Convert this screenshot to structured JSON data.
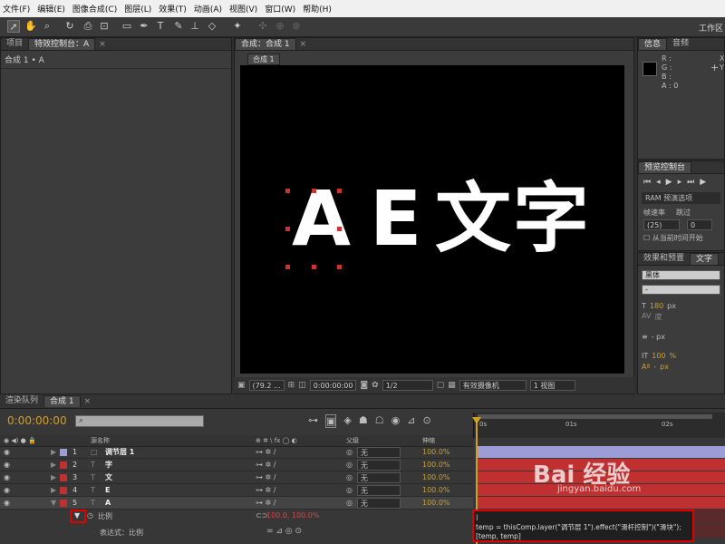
{
  "menu": [
    "文件(F)",
    "编辑(E)",
    "图像合成(C)",
    "图层(L)",
    "效果(T)",
    "动画(A)",
    "视图(V)",
    "窗口(W)",
    "帮助(H)"
  ],
  "workspace_label": "工作区",
  "left_panel": {
    "tabs": [
      "项目",
      "特效控制台：A"
    ],
    "subtitle": "合成 1 • A"
  },
  "viewer": {
    "tab": "合成：合成 1",
    "subtab": "合成 1",
    "comp_text": [
      "A",
      "E",
      "文",
      "字"
    ],
    "controls": {
      "zoom": "(79.2 ...",
      "time": "0:00:00:00",
      "resolution": "1/2",
      "camera": "有效摄像机",
      "views": "1 视图"
    }
  },
  "info_panel": {
    "tabs": [
      "信息",
      "音频"
    ],
    "r": "R :",
    "g": "G :",
    "b": "B :",
    "a": "A : 0",
    "x": "X",
    "y": "Y"
  },
  "preview_panel": {
    "tab": "预览控制台",
    "ram": "RAM 预演选项",
    "framerate_label": "帧速率",
    "skip_label": "跳过",
    "framerate_value": "(25)",
    "skip_value": "0",
    "from_current": "从当前时间开始"
  },
  "char_panel": {
    "tabs": [
      "效果和预置",
      "文字"
    ],
    "font": "黑体",
    "style": "-",
    "size": "180",
    "size_unit": "px",
    "tracking": "度",
    "leading_unit": "- px",
    "vscale": "100",
    "vscale_unit": "%",
    "baseline": "-",
    "baseline_unit": "px"
  },
  "timeline": {
    "tabs": [
      "渲染队列",
      "合成 1"
    ],
    "timecode": "0:00:00:00",
    "col_name": "源名称",
    "col_parent": "父级",
    "col_stretch": "伸缩",
    "ticks": [
      "0s",
      "01s",
      "02s"
    ],
    "layers": [
      {
        "num": "1",
        "name": "调节层 1",
        "color": "#9c9cd6",
        "parent": "无",
        "stretch": "100.0%"
      },
      {
        "num": "2",
        "name": "字",
        "color": "#c03030",
        "parent": "无",
        "stretch": "100.0%"
      },
      {
        "num": "3",
        "name": "文",
        "color": "#c03030",
        "parent": "无",
        "stretch": "100.0%"
      },
      {
        "num": "4",
        "name": "E",
        "color": "#c03030",
        "parent": "无",
        "stretch": "100.0%"
      },
      {
        "num": "5",
        "name": "A",
        "color": "#c03030",
        "parent": "无",
        "stretch": "100.0%"
      }
    ],
    "property": {
      "name": "比例",
      "value": "100.0, 100.0%"
    },
    "expression_label": "表达式：比例",
    "expression_code": [
      "temp = thisComp.layer(\"调节层 1\").effect(\"滑杆控制\")(\"滑块\");",
      "[temp, temp]"
    ]
  },
  "watermark": "Bai 经验",
  "watermark_url": "jingyan.baidu.com",
  "colors": {
    "accent": "#d2a020",
    "highlight": "#e00000",
    "layer_bar": "#c03030",
    "adjust_bar": "#9c9cd6"
  }
}
